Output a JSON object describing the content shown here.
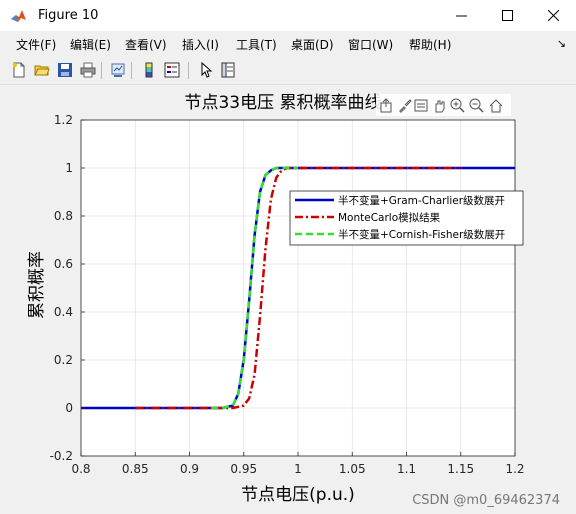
{
  "window": {
    "title": "Figure 10",
    "minimize_icon": "minimize-icon",
    "maximize_icon": "maximize-icon",
    "close_icon": "close-icon"
  },
  "menu": {
    "items": [
      "文件(F)",
      "编辑(E)",
      "查看(V)",
      "插入(I)",
      "工具(T)",
      "桌面(D)",
      "窗口(W)",
      "帮助(H)"
    ],
    "overflow_icon": "arrow-icon"
  },
  "toolbar": {
    "buttons": [
      "new-figure-icon",
      "open-file-icon",
      "save-icon",
      "print-icon",
      "link-plot-icon",
      "insert-colorbar-icon",
      "insert-legend-icon",
      "edit-plot-icon",
      "property-inspector-icon"
    ]
  },
  "axes_toolbar": [
    "export-icon",
    "brush-icon",
    "data-tips-icon",
    "pan-icon",
    "zoom-in-icon",
    "zoom-out-icon",
    "home-icon"
  ],
  "chart_data": {
    "type": "line",
    "title": "节点33电压 累积概率曲线",
    "xlabel": "节点电压(p.u.)",
    "ylabel": "累积概率",
    "xlim": [
      0.8,
      1.2
    ],
    "ylim": [
      -0.2,
      1.2
    ],
    "xticks": [
      "0.8",
      "0.85",
      "0.9",
      "0.95",
      "1",
      "1.05",
      "1.1",
      "1.15",
      "1.2"
    ],
    "yticks": [
      "-0.2",
      "0",
      "0.2",
      "0.4",
      "0.6",
      "0.8",
      "1",
      "1.2"
    ],
    "grid": true,
    "legend_position": "right",
    "series": [
      {
        "name": "半不变量+Gram-Charlier级数展开",
        "color": "#0000cc",
        "style": "solid",
        "x": [
          0.8,
          0.93,
          0.94,
          0.945,
          0.95,
          0.955,
          0.96,
          0.965,
          0.97,
          0.975,
          0.98,
          0.99,
          1.2
        ],
        "y": [
          0,
          0,
          0.01,
          0.06,
          0.2,
          0.45,
          0.72,
          0.9,
          0.97,
          0.99,
          1.0,
          1.0,
          1.0
        ]
      },
      {
        "name": "MonteCarlo模拟结果",
        "color": "#cc0000",
        "style": "dashdot",
        "x": [
          0.85,
          0.94,
          0.95,
          0.955,
          0.96,
          0.965,
          0.97,
          0.975,
          0.98,
          0.985,
          0.99,
          1.0,
          1.15
        ],
        "y": [
          0,
          0,
          0.01,
          0.04,
          0.14,
          0.38,
          0.66,
          0.87,
          0.96,
          0.99,
          1.0,
          1.0,
          1.0
        ]
      },
      {
        "name": "半不变量+Cornish-Fisher级数展开",
        "color": "#33dd33",
        "style": "dashed",
        "x": [
          0.92,
          0.93,
          0.94,
          0.945,
          0.95,
          0.955,
          0.96,
          0.965,
          0.97,
          0.975,
          0.98,
          0.99,
          1.0
        ],
        "y": [
          0,
          0,
          0.01,
          0.06,
          0.2,
          0.45,
          0.72,
          0.9,
          0.97,
          0.99,
          1.0,
          1.0,
          1.0
        ]
      }
    ]
  },
  "watermark": "CSDN @m0_69462374"
}
